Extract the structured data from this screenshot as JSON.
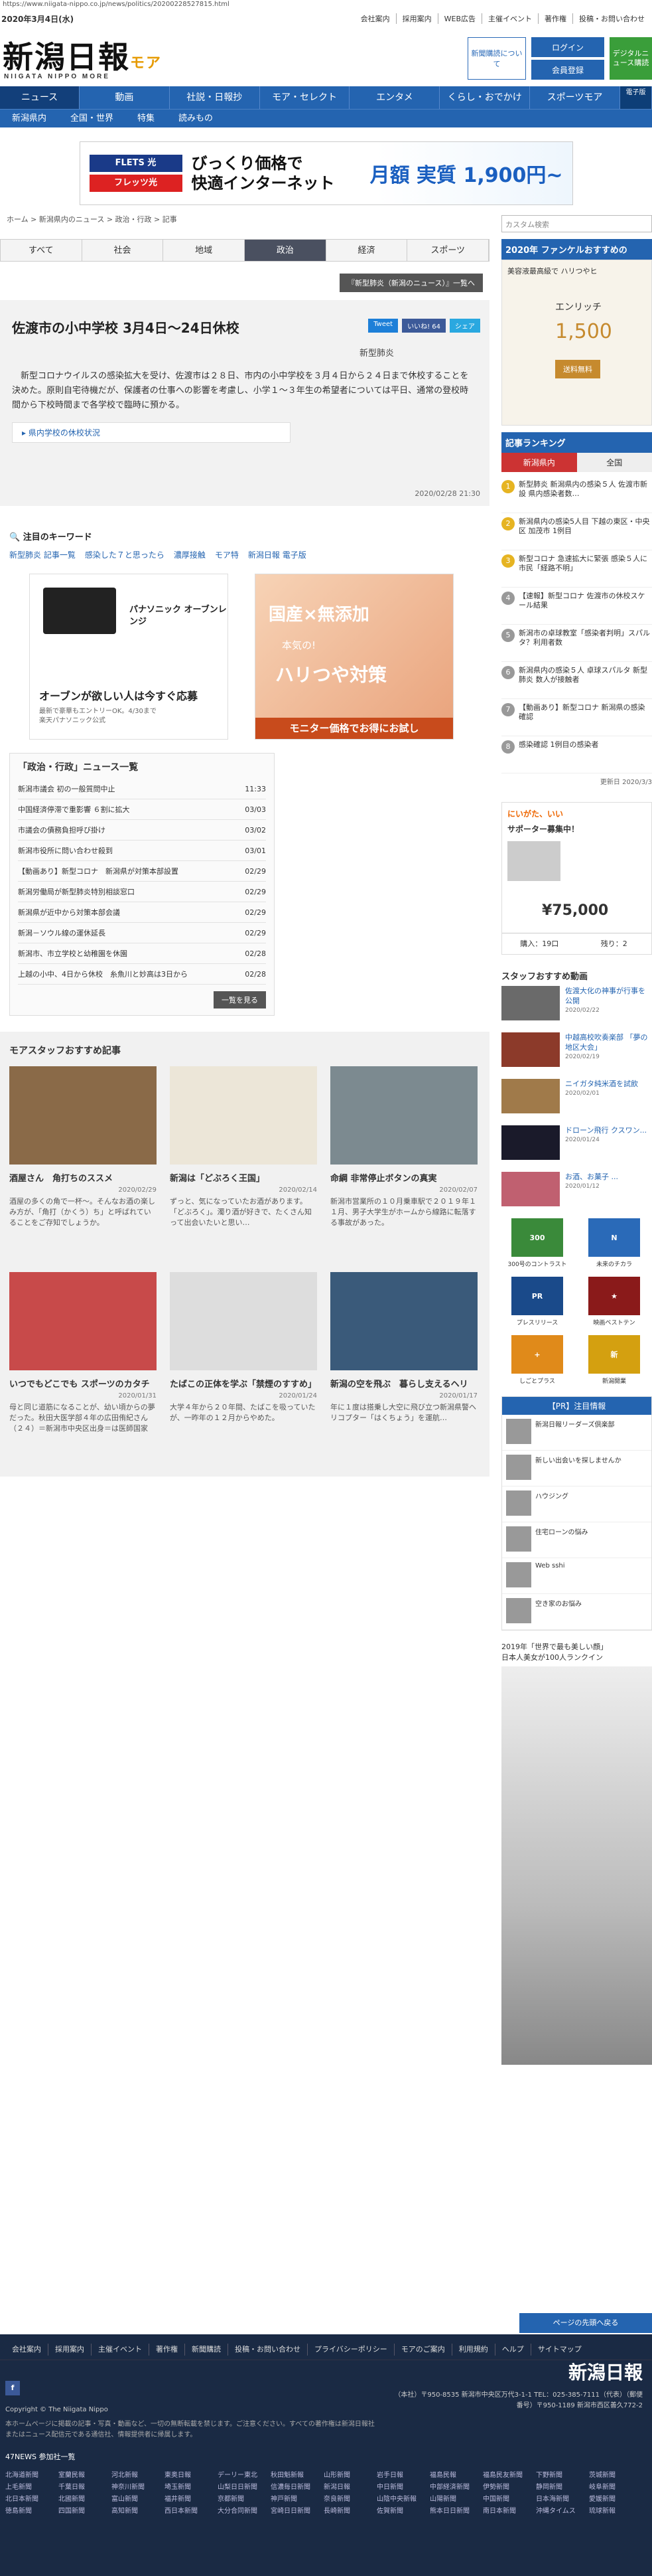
{
  "url": "https://www.niigata-nippo.co.jp/news/politics/20200228527815.html",
  "header": {
    "date": "2020年3月4日(水)",
    "links": [
      "会社案内",
      "採用案内",
      "WEB広告",
      "主催イベント",
      "著作権",
      "投稿・お問い合わせ"
    ],
    "logo": "新潟日報",
    "logo_sub": "NIIGATA NIPPO MORE",
    "logo_more": "モア",
    "subscribe": "新聞購読について",
    "login": "ログイン",
    "register": "会員登録",
    "digital": "デジタルニュース購読"
  },
  "nav": [
    "ニュース",
    "動画",
    "社説・日報抄",
    "モア・セレクト",
    "エンタメ",
    "くらし・おでかけ",
    "スポーツモア",
    "電子版"
  ],
  "subnav": [
    "新潟県内",
    "全国・世界",
    "特集",
    "読みもの"
  ],
  "topad": {
    "l1": "FLETS 光",
    "l2": "フレッツ光",
    "text1": "びっくり価格で",
    "text2": "快適インターネット",
    "price": "月額 実質 1,900円~"
  },
  "breadcrumb": "ホーム > 新潟県内のニュース > 政治・行政 > 記事",
  "tabs": [
    "すべて",
    "社会",
    "地域",
    "政治",
    "経済",
    "スポーツ"
  ],
  "covidbtn": "『新型肺炎（新潟のニュース）』一覧へ",
  "article": {
    "title": "佐渡市の小中学校 3月4日～24日休校",
    "share": [
      "Tweet",
      "いいね! 64",
      "シェア"
    ],
    "source": "新型肺炎",
    "body": "　新型コロナウイルスの感染拡大を受け、佐渡市は２８日、市内の小中学校を３月４日から２４日まで休校することを決めた。原則自宅待機だが、保護者の仕事への影響を考慮し、小学１～３年生の希望者については平日、通常の登校時間から下校時間まで各学校で臨時に預かる。",
    "related": "県内学校の休校状況",
    "datetime": "2020/02/28 21:30"
  },
  "keywords": {
    "title": "注目のキーワード",
    "items": [
      "新型肺炎 記事一覧",
      "感染した７と思ったら",
      "濃厚接触",
      "モア特",
      "新潟日報 電子版"
    ]
  },
  "ad1": {
    "brand": "パナソニック オーブンレンジ",
    "headline": "オーブンが欲しい人は今すぐ応募",
    "sub": "最新で豪華もエントリーOK。4/30まで",
    "sub2": "楽天パナソニック公式"
  },
  "ad2": {
    "l1": "国産×無添加",
    "l2": "本気の!",
    "l3": "ハリつや対策",
    "btn": "モニター価格でお得にお試し"
  },
  "newslist": {
    "title": "「政治・行政」ニュース一覧",
    "items": [
      [
        "新潟市議会 初の一般質問中止",
        "11:33"
      ],
      [
        "中国経済停滞で重影響 ６割に拡大",
        "03/03"
      ],
      [
        "市議会の債務負担呼び掛け",
        "03/02"
      ],
      [
        "新潟市役所に問い合わせ殺到",
        "03/01"
      ],
      [
        "【動画あり】新型コロナ　新潟県が対策本部設置",
        "02/29"
      ],
      [
        "新潟労働局が新型肺炎特別相談窓口",
        "02/29"
      ],
      [
        "新潟県が近中から対策本部会議",
        "02/29"
      ],
      [
        "新潟－ソウル線の運休延長",
        "02/29"
      ],
      [
        "新潟市、市立学校と幼稚園を休園",
        "02/28"
      ],
      [
        "上越の小中、4日から休校　糸魚川と妙高は3日から",
        "02/28"
      ]
    ],
    "more": "一覧を見る"
  },
  "staff": {
    "title": "モアスタッフおすすめ記事",
    "cards": [
      [
        "酒屋さん　角打ちのススメ",
        "2020/02/29",
        "酒屋の多くの角で一杯～。そんなお酒の楽しみ方が、「角打（かくう）ち」と呼ばれていることをご存知でしょうか。"
      ],
      [
        "新潟は「どぶろく王国」",
        "2020/02/14",
        "ずっと、気になっていたお酒があります。「どぶろく」。濁り酒が好きで、たくさん知って出会いたいと思い…"
      ],
      [
        "命綱 非常停止ボタンの真実",
        "2020/02/07",
        "新潟市営業所の１０月乗車駅で２０１９年１１月、男子大学生がホームから線路に転落する事故があった。"
      ],
      [
        "いつでもどこでも スポーツのカタチ",
        "2020/01/31",
        "母と同じ道筋になることが、幼い頃からの夢だった。秋田大医学部４年の広田侑紀さん（２４）＝新潟市中央区出身＝は医師国家試…"
      ],
      [
        "たばこの正体を学ぶ「禁煙のすすめ」",
        "2020/01/24",
        "大学４年から２０年間、たばこを吸っていたが、一昨年の１２月からやめた。"
      ],
      [
        "新潟の空を飛ぶ　暮らし支えるヘリ",
        "2020/01/17",
        "年に１度は搭乗し大空に飛び立つ新潟県警ヘリコプター「はくちょう」を運航…"
      ]
    ]
  },
  "side": {
    "search": "カスタム検索",
    "fancl_hdr": "2020年 ファンケルおすすめの",
    "fancl_sub": "美容液最高級で ハリつやヒ",
    "fancl_t2": "エンリッチ",
    "fancl_price": "1,500",
    "fancl_btn": "送料無料",
    "rank_title": "記事ランキング",
    "rank_tabs": [
      "新潟県内",
      "全国"
    ],
    "rank": [
      "新型肺炎 新潟県内の感染５人 佐渡市新設 県内感染者数…",
      "新潟県内の感染5人目 下越の東区・中央区 加茂市 1例目",
      "新型コロナ 急速拡大に緊張 感染５人に 市民「経路不明」",
      "【速報】新型コロナ 佐渡市の休校スケール結果",
      "新潟市の卓球教室「感染者判明」スパルタ？利用者数",
      "新潟県内の感染５人 卓球スパルタ 新型肺炎 数人が接触者",
      "【動画あり】新型コロナ 新潟県の感染確認",
      "感染確認 1例目の感染者"
    ],
    "updated": "更新日 2020/3/3",
    "sponsor_top": "にいがた、いい",
    "sponsor_title": "サポーター募集中！",
    "sponsor_price": "¥75,000",
    "buy": "購入：19口",
    "left": "残り：2",
    "staff_title": "スタッフおすすめ動画",
    "videos": [
      [
        "佐渡大化の神事が行事を公開",
        "2020/02/22"
      ],
      [
        "中越高校吹奏楽部 「夢の地区大会」",
        "2020/02/19"
      ],
      [
        "ニイガタ純米酒を試飲",
        "2020/02/01"
      ],
      [
        "ドローン飛行 クスワン...",
        "2020/01/24"
      ],
      [
        "お酒、お菓子 ...",
        "2020/01/12"
      ]
    ],
    "icons": [
      "300号のコントラスト",
      "未来のチカラ",
      "プレスリリース",
      "映画ベストテン",
      "しごとプラス",
      "新潟開業"
    ],
    "pr_title": "【PR】注目情報",
    "pr": [
      "新潟日報リーダーズ倶楽部",
      "新しい出会いを探しませんか",
      "ハウジング",
      "住宅ローンの悩み",
      "Web sshi",
      "空き家のお悩み"
    ],
    "bigad_title": "2019年「世界で最も美しい顔」",
    "bigad_sub": "日本人美女が100人ランクイン"
  },
  "pagetop": "ページの先頭へ戻る",
  "footer": {
    "links": [
      "会社案内",
      "採用案内",
      "主催イベント",
      "著作権",
      "新聞購読",
      "投稿・お問い合わせ",
      "プライバシーポリシー",
      "モアのご案内",
      "利用規約",
      "ヘルプ",
      "サイトマップ"
    ],
    "logo": "新潟日報",
    "copyright": "Copyright © The Niigata Nippo",
    "note": "本ホームページに掲載の記事・写真・動画など、一切の無断転載を禁じます。ご注意ください。すべての著作権は新潟日報社またはニュース配信元である通信社、情報提供者に帰属します。",
    "addr": "（本社）〒950-8535 新潟市中央区万代3-1-1 TEL：025-385-7111（代表）（郵便番号）〒950-1189 新潟市西区善久772-2",
    "n47": "47NEWS 参加社一覧",
    "papers": [
      "北海道新聞",
      "室蘭民報",
      "河北新報",
      "東奥日報",
      "デーリー東北",
      "秋田魁新報",
      "山形新聞",
      "岩手日報",
      "福島民報",
      "福島民友新聞",
      "下野新聞",
      "茨城新聞",
      "上毛新聞",
      "千葉日報",
      "神奈川新聞",
      "埼玉新聞",
      "山梨日日新聞",
      "信濃毎日新聞",
      "新潟日報",
      "中日新聞",
      "中部経済新聞",
      "伊勢新聞",
      "静岡新聞",
      "岐阜新聞",
      "北日本新聞",
      "北國新聞",
      "富山新聞",
      "福井新聞",
      "京都新聞",
      "神戸新聞",
      "奈良新聞",
      "山陰中央新報",
      "山陽新聞",
      "中国新聞",
      "日本海新聞",
      "愛媛新聞",
      "徳島新聞",
      "四国新聞",
      "高知新聞",
      "西日本新聞",
      "大分合同新聞",
      "宮崎日日新聞",
      "長崎新聞",
      "佐賀新聞",
      "熊本日日新聞",
      "南日本新聞",
      "沖縄タイムス",
      "琉球新報"
    ]
  }
}
